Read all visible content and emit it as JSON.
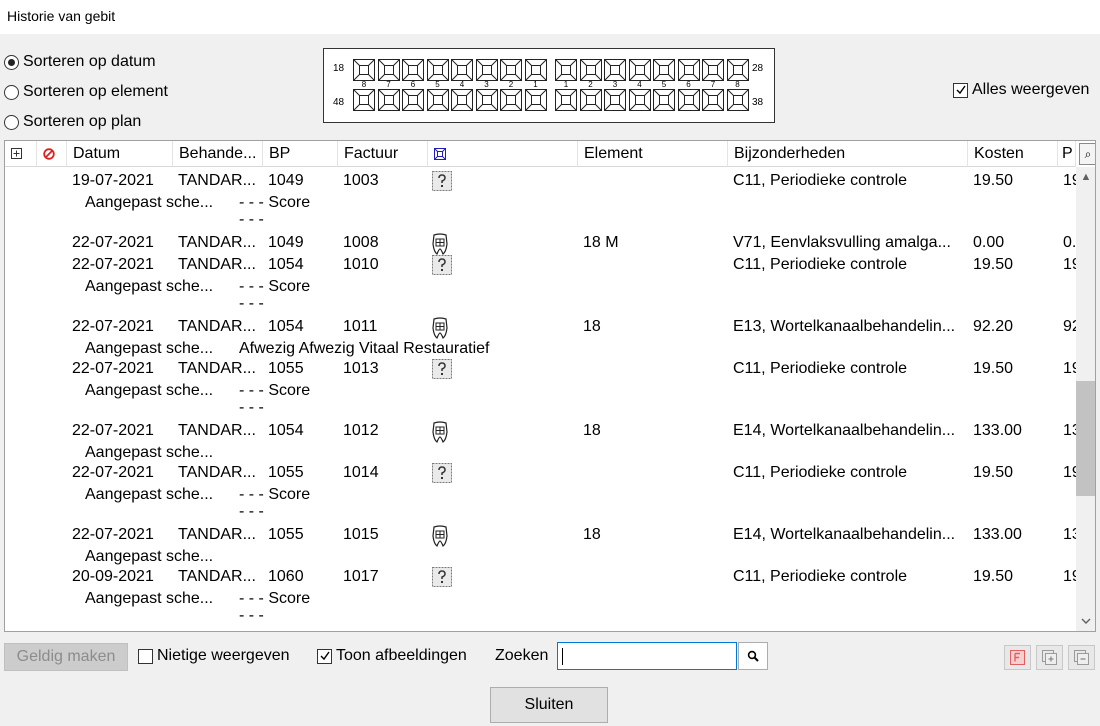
{
  "window": {
    "title": "Historie van gebit"
  },
  "sort": {
    "options": [
      {
        "label": "Sorteren op datum",
        "selected": true
      },
      {
        "label": "Sorteren op element",
        "selected": false
      },
      {
        "label": "Sorteren op plan",
        "selected": false
      }
    ]
  },
  "dental_chart": {
    "quadrant_labels": {
      "q1": "18",
      "q2": "28",
      "q3": "38",
      "q4": "48"
    },
    "numbers": [
      "8",
      "7",
      "6",
      "5",
      "4",
      "3",
      "2",
      "1",
      "1",
      "2",
      "3",
      "4",
      "5",
      "6",
      "7",
      "8"
    ]
  },
  "alles_weergeven": {
    "label": "Alles weergeven",
    "checked": true
  },
  "table": {
    "headers": {
      "expand": "⊞",
      "datum": "Datum",
      "behandelaar": "Behande...",
      "bp": "BP",
      "factuur": "Factuur",
      "element": "Element",
      "bijzonderheden": "Bijzonderheden",
      "kosten": "Kosten",
      "p": "P"
    },
    "rows": [
      {
        "main": {
          "datum": "19-07-2021",
          "beh": "TANDAR...",
          "bp": "1049",
          "factuur": "1003",
          "icon": "question",
          "element": "",
          "bijz": "C11, Periodieke controle",
          "kosten": "19.50",
          "p": "19"
        },
        "sub": {
          "beh": "Aangepast sche...",
          "extra": "- - - Score"
        },
        "dash": "- - -"
      },
      {
        "main": {
          "datum": "22-07-2021",
          "beh": "TANDAR...",
          "bp": "1049",
          "factuur": "1008",
          "icon": "tooth",
          "element": "18 M",
          "bijz": "V71, Eenvlaksvulling amalga...",
          "kosten": "0.00",
          "p": "0."
        }
      },
      {
        "main": {
          "datum": "22-07-2021",
          "beh": "TANDAR...",
          "bp": "1054",
          "factuur": "1010",
          "icon": "question",
          "element": "",
          "bijz": "C11, Periodieke controle",
          "kosten": "19.50",
          "p": "19"
        },
        "sub": {
          "beh": "Aangepast sche...",
          "extra": "- - - Score"
        },
        "dash": "- - -"
      },
      {
        "main": {
          "datum": "22-07-2021",
          "beh": "TANDAR...",
          "bp": "1054",
          "factuur": "1011",
          "icon": "tooth",
          "element": "18",
          "bijz": "E13, Wortelkanaalbehandelin...",
          "kosten": "92.20",
          "p": "92"
        },
        "sub": {
          "beh": "Aangepast sche...",
          "extra": "Afwezig Afwezig Vitaal Restauratief"
        }
      },
      {
        "main": {
          "datum": "22-07-2021",
          "beh": "TANDAR...",
          "bp": "1055",
          "factuur": "1013",
          "icon": "question",
          "element": "",
          "bijz": "C11, Periodieke controle",
          "kosten": "19.50",
          "p": "19"
        },
        "sub": {
          "beh": "Aangepast sche...",
          "extra": "- - - Score"
        },
        "dash": "- - -"
      },
      {
        "main": {
          "datum": "22-07-2021",
          "beh": "TANDAR...",
          "bp": "1054",
          "factuur": "1012",
          "icon": "tooth",
          "element": "18",
          "bijz": "E14, Wortelkanaalbehandelin...",
          "kosten": "133.00",
          "p": "13"
        },
        "sub": {
          "beh": "Aangepast sche...",
          "extra": ""
        }
      },
      {
        "main": {
          "datum": "22-07-2021",
          "beh": "TANDAR...",
          "bp": "1055",
          "factuur": "1014",
          "icon": "question",
          "element": "",
          "bijz": "C11, Periodieke controle",
          "kosten": "19.50",
          "p": "19"
        },
        "sub": {
          "beh": "Aangepast sche...",
          "extra": "- - - Score"
        },
        "dash": "- - -"
      },
      {
        "main": {
          "datum": "22-07-2021",
          "beh": "TANDAR...",
          "bp": "1055",
          "factuur": "1015",
          "icon": "tooth",
          "element": "18",
          "bijz": "E14, Wortelkanaalbehandelin...",
          "kosten": "133.00",
          "p": "13"
        },
        "sub": {
          "beh": "Aangepast sche...",
          "extra": ""
        }
      },
      {
        "main": {
          "datum": "20-09-2021",
          "beh": "TANDAR...",
          "bp": "1060",
          "factuur": "1017",
          "icon": "question",
          "element": "",
          "bijz": "C11, Periodieke controle",
          "kosten": "19.50",
          "p": "19"
        },
        "sub": {
          "beh": "Aangepast sche...",
          "extra": "- - - Score"
        },
        "dash": "- - -"
      }
    ]
  },
  "footer": {
    "geldig_maken": "Geldig maken",
    "nietige_weergeven": {
      "label": "Nietige weergeven",
      "checked": false
    },
    "toon_afbeeldingen": {
      "label": "Toon afbeeldingen",
      "checked": true
    },
    "zoeken_label": "Zoeken",
    "zoeken_value": "",
    "sluiten": "Sluiten"
  },
  "colors": {
    "accent": "#0078d7",
    "red_icon": "#e02020",
    "blue_icon": "#2020c0"
  }
}
